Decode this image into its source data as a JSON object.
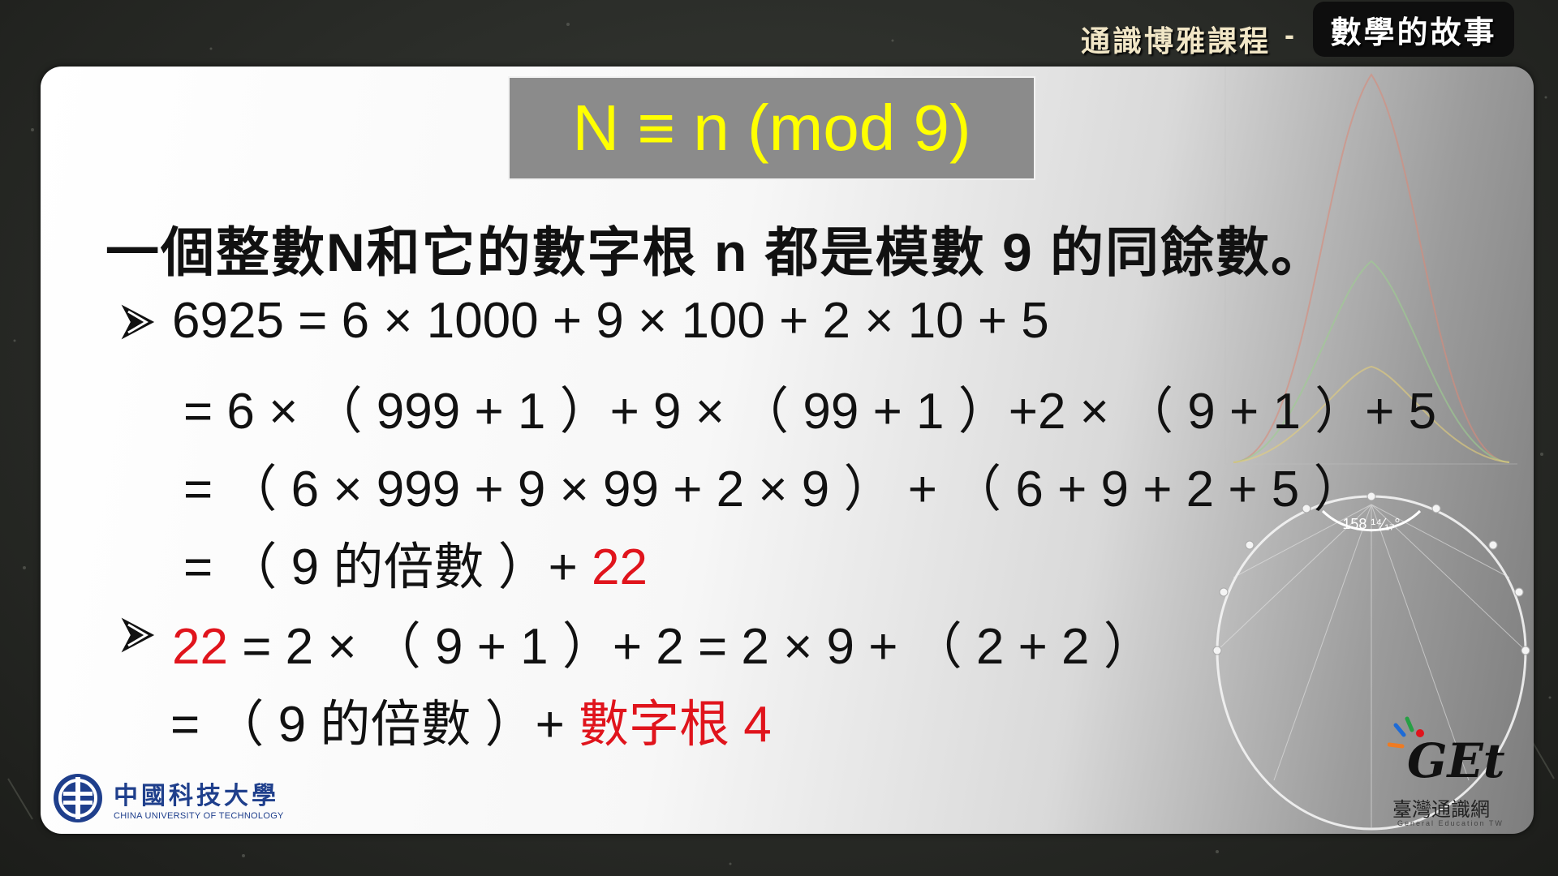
{
  "header": {
    "course_label": "通識博雅課程",
    "separator": "-",
    "topic": "數學的故事"
  },
  "slide": {
    "title": "N ≡ n (mod 9)",
    "statement": "一個整數N和它的數字根 n 都是模數 9 的同餘數。",
    "line1": "6925 = 6 × 1000 + 9 × 100 + 2 × 10 + 5",
    "line2": "= 6 × （ 999 + 1 ）+ 9 × （ 99 + 1 ）+2 × （ 9 + 1 ）+ 5",
    "line3": "= （ 6 ×  999 + 9 ×  99 + 2 ×  9 ）  + （ 6 + 9 + 2 + 5 ）",
    "line4_prefix": "= （ 9 的倍數 ）+ ",
    "line4_value": "22",
    "line5_value": "22",
    "line5_rest": " = 2 × （ 9 + 1 ）+ 2 = 2 × 9 + （ 2 + 2 ）",
    "line6_prefix": "= （ 9 的倍數 ）+  ",
    "line6_highlight": "數字根 4"
  },
  "decoration": {
    "protractor_label": "158 ¹⁴⁄₁₇°"
  },
  "footer": {
    "school_cn": "中國科技大學",
    "school_en": "CHINA UNIVERSITY OF TECHNOLOGY",
    "get_logo_text": "GEt",
    "get_cn": "臺灣通識網",
    "get_en": "General Education TW"
  },
  "colors": {
    "title_text": "#ffff00",
    "title_bg": "#8b8b8b",
    "highlight": "#e0141c",
    "body_text": "#111111",
    "school_blue": "#1f3f8c"
  }
}
